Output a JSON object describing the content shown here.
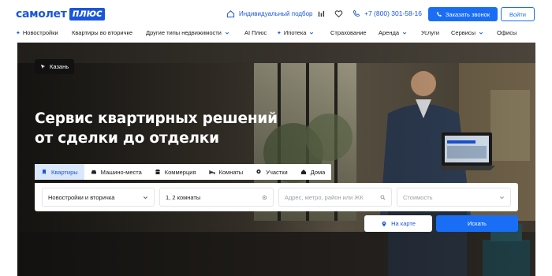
{
  "header": {
    "logo_text": "самолет",
    "logo_plus": "плюс",
    "individual_label": "Индивидуальный подбор",
    "phone": "+7 (800) 301-58-16",
    "call_button": "Заказать звонок",
    "login_button": "Войти"
  },
  "nav": {
    "items": [
      {
        "label": "Новостройки",
        "star": true,
        "dropdown": false
      },
      {
        "label": "Квартиры во вторичке",
        "star": false,
        "dropdown": false
      },
      {
        "label": "Другие типы недвижимости",
        "star": false,
        "dropdown": true
      },
      {
        "label": "AI Плюс",
        "star": false,
        "dropdown": false
      },
      {
        "label": "Ипотека",
        "star": true,
        "dropdown": true
      },
      {
        "label": "Страхование",
        "star": false,
        "dropdown": false
      },
      {
        "label": "Аренда",
        "star": false,
        "dropdown": true
      },
      {
        "label": "Услуги",
        "star": false,
        "dropdown": false
      },
      {
        "label": "Сервисы",
        "star": false,
        "dropdown": true
      },
      {
        "label": "Офисы",
        "star": false,
        "dropdown": false
      }
    ]
  },
  "hero": {
    "city": "Казань",
    "headline_line1": "Сервис квартирных решений",
    "headline_line2": "от сделки до отделки"
  },
  "tabs": [
    {
      "label": "Квартиры",
      "icon": "bookmark-icon",
      "active": true
    },
    {
      "label": "Машино-места",
      "icon": "car-icon",
      "active": false
    },
    {
      "label": "Коммерция",
      "icon": "store-icon",
      "active": false
    },
    {
      "label": "Комнаты",
      "icon": "bed-icon",
      "active": false
    },
    {
      "label": "Участки",
      "icon": "pin-icon",
      "active": false
    },
    {
      "label": "Дома",
      "icon": "house-icon",
      "active": false
    }
  ],
  "search": {
    "type_value": "Новостройки и вторичка",
    "rooms_value": "1, 2 комнаты",
    "address_placeholder": "Адрес, метро, район или ЖК",
    "price_placeholder": "Стоимость"
  },
  "actions": {
    "map_button": "На карте",
    "search_button": "Искать"
  },
  "colors": {
    "brand": "#1a56db",
    "button": "#1a6ef5",
    "active_tab": "#dbe7fb"
  }
}
